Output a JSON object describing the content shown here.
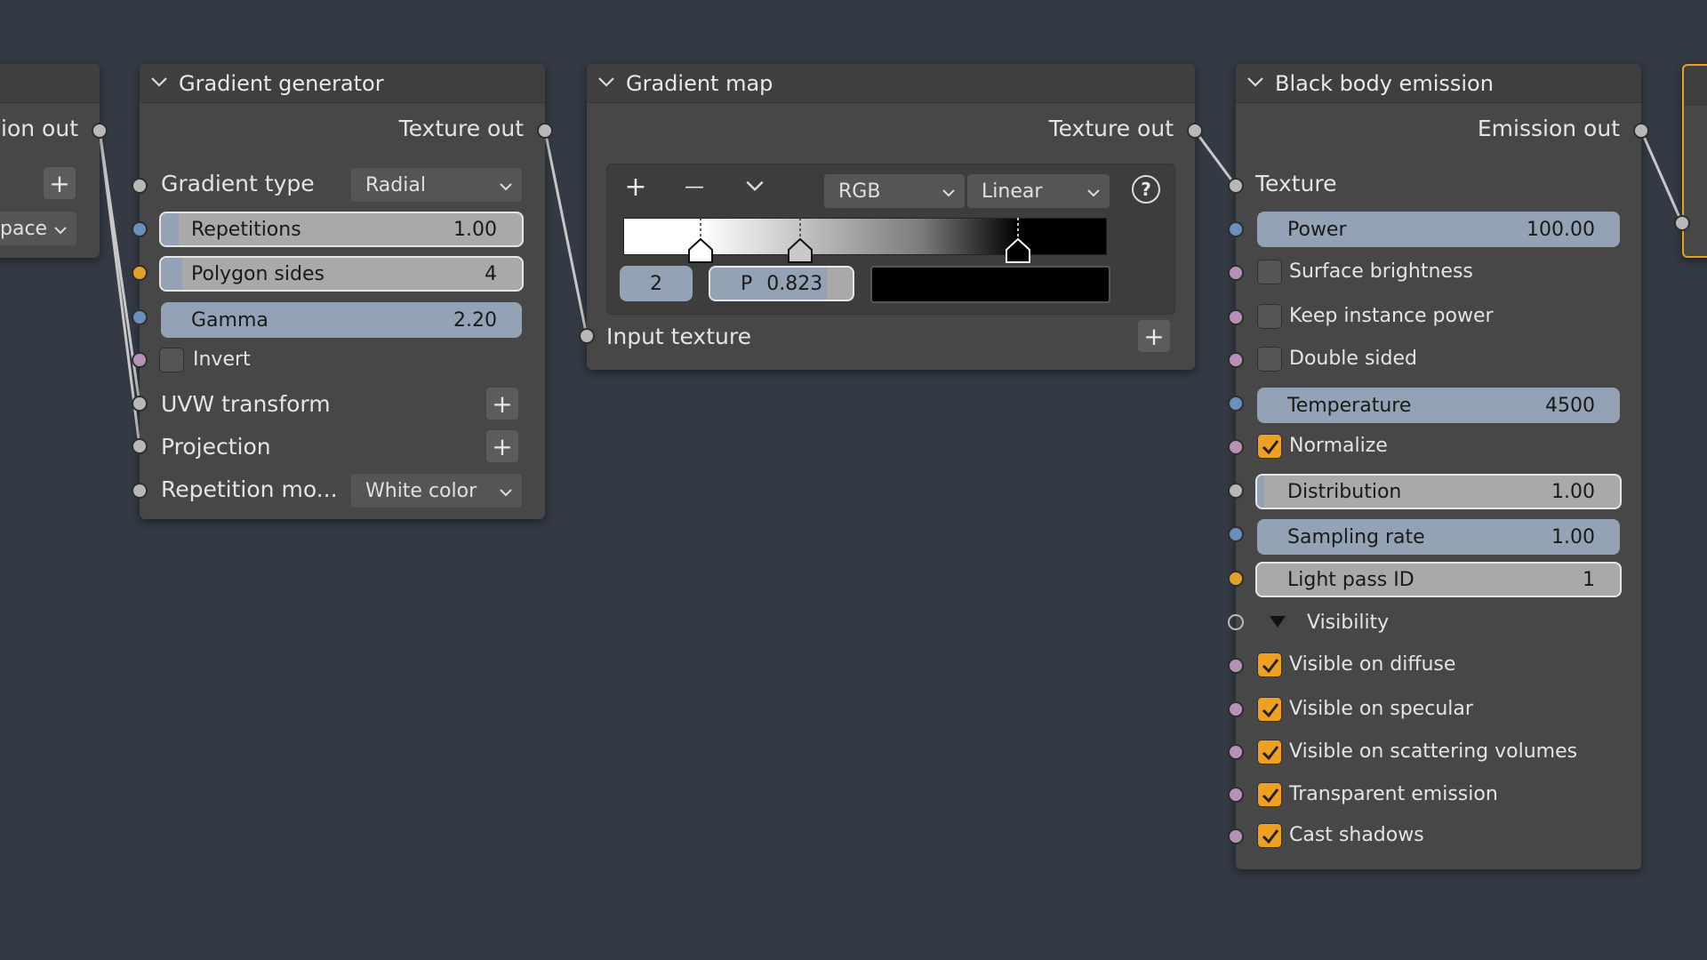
{
  "left_node": {
    "output_label": "ion out",
    "dropdown_value": "pace"
  },
  "gradient_generator": {
    "title": "Gradient generator",
    "output_label": "Texture out",
    "gradient_type_label": "Gradient type",
    "gradient_type_value": "Radial",
    "repetitions_label": "Repetitions",
    "repetitions_value": "1.00",
    "polygon_sides_label": "Polygon sides",
    "polygon_sides_value": "4",
    "gamma_label": "Gamma",
    "gamma_value": "2.20",
    "invert_label": "Invert",
    "invert_checked": false,
    "uvw_label": "UVW transform",
    "projection_label": "Projection",
    "repetition_mode_label": "Repetition mo...",
    "repetition_mode_value": "White color"
  },
  "gradient_map": {
    "title": "Gradient map",
    "output_label": "Texture out",
    "add_stop": "+",
    "remove_stop": "—",
    "color_space": "RGB",
    "interpolation": "Linear",
    "help": "?",
    "stop_index": "2",
    "position_prefix": "P",
    "position_value": "0.823",
    "stop_color": "#000000",
    "input_label": "Input texture"
  },
  "black_body": {
    "title": "Black body emission",
    "output_label": "Emission out",
    "texture_label": "Texture",
    "power_label": "Power",
    "power_value": "100.00",
    "surface_brightness_label": "Surface brightness",
    "surface_brightness_checked": false,
    "keep_instance_power_label": "Keep instance power",
    "keep_instance_power_checked": false,
    "double_sided_label": "Double sided",
    "double_sided_checked": false,
    "temperature_label": "Temperature",
    "temperature_value": "4500",
    "normalize_label": "Normalize",
    "normalize_checked": true,
    "distribution_label": "Distribution",
    "distribution_value": "1.00",
    "sampling_rate_label": "Sampling rate",
    "sampling_rate_value": "1.00",
    "light_pass_label": "Light pass ID",
    "light_pass_value": "1",
    "visibility_label": "Visibility",
    "visible_diffuse_label": "Visible on diffuse",
    "visible_specular_label": "Visible on specular",
    "visible_scattering_label": "Visible on scattering volumes",
    "transparent_emission_label": "Transparent emission",
    "cast_shadows_label": "Cast shadows"
  },
  "colors": {
    "background": "#333a44",
    "node_body": "#474747",
    "accent_checkbox": "#f0a020",
    "selected_node_outline": "#e8a020"
  }
}
